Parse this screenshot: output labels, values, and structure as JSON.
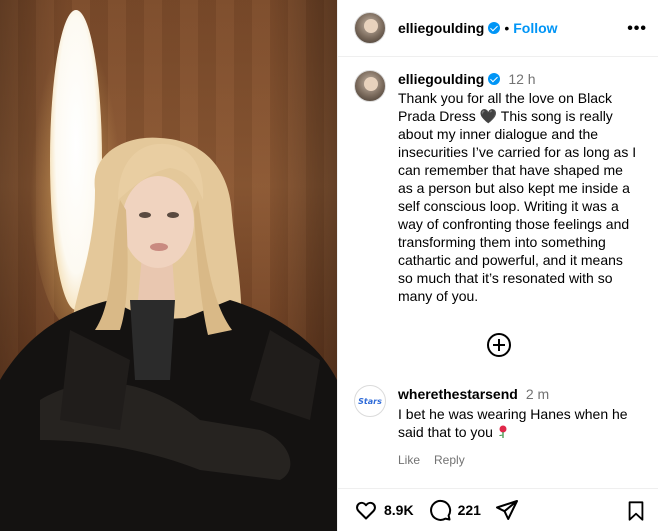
{
  "post": {
    "username": "elliegoulding",
    "follow_label": "Follow",
    "dot": "•",
    "more_label": "•••",
    "time": "12 h",
    "caption": "Thank you for all the love on Black Prada Dress 🖤 This song is really about my inner dialogue and the insecurities I’ve carried for as long as I can remember that have shaped me as a person but also kept me inside a self conscious loop. Writing it was a way of confronting those feelings and transforming them into something cathartic and powerful, and it means so much that it’s resonated with so many of you."
  },
  "comment": {
    "username": "wherethestarsend",
    "time": "2 m",
    "text": "I bet he was wearing Hanes when he said that to you",
    "avatar_text": "Stars",
    "like_label": "Like",
    "reply_label": "Reply"
  },
  "footer": {
    "likes": "8.9K",
    "comments": "221"
  },
  "icons": {
    "more": "more-options-icon",
    "verified": "verified-badge-icon",
    "load_more": "plus-circle-icon",
    "like": "heart-icon",
    "comment": "comment-icon",
    "share": "send-icon",
    "save": "bookmark-icon"
  },
  "colors": {
    "accent": "#0095f6",
    "muted": "#737373"
  }
}
